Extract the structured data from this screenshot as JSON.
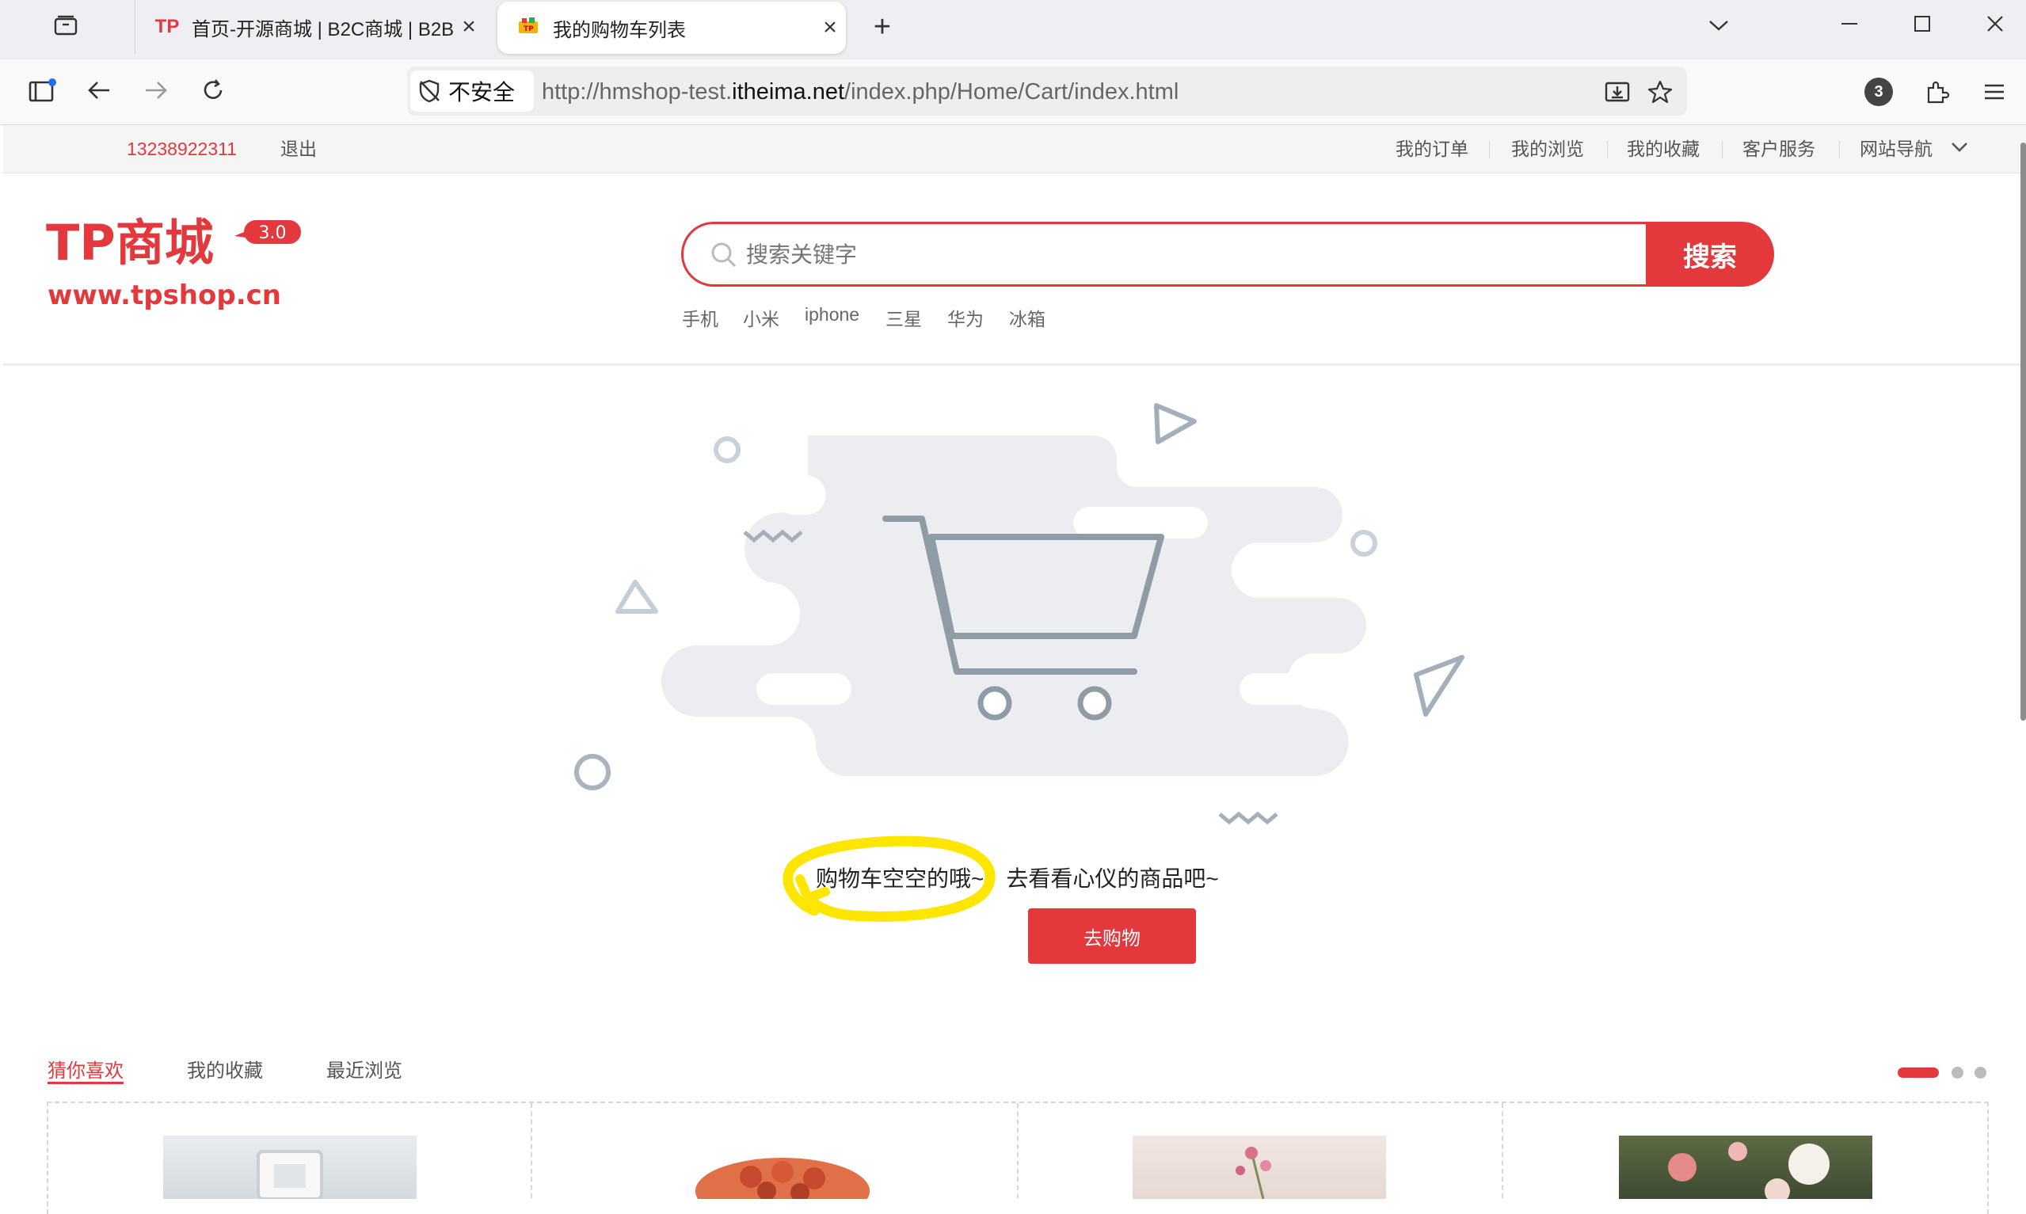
{
  "browser": {
    "tabs": [
      {
        "favicon": "TP",
        "title": "首页-开源商城 | B2C商城 | B2B"
      },
      {
        "favicon": "cart-favicon",
        "title": "我的购物车列表"
      }
    ],
    "security_label": "不安全",
    "url": {
      "scheme_host_prefix": "http://hmshop-test.",
      "domain": "itheima.net",
      "path": "/index.php/Home/Cart/index.html"
    },
    "extensions_badge": "3"
  },
  "site": {
    "topbar": {
      "phone": "13238922311",
      "logout": "退出",
      "links": [
        "我的订单",
        "我的浏览",
        "我的收藏",
        "客户服务",
        "网站导航"
      ]
    },
    "logo": {
      "name": "TP商城",
      "version": "3.0",
      "domain": "www.tpshop.cn"
    },
    "search": {
      "placeholder": "搜索关键字",
      "button": "搜索",
      "hotwords": [
        "手机",
        "小米",
        "iphone",
        "三星",
        "华为",
        "冰箱"
      ]
    },
    "cart": {
      "empty_message": "购物车空空的哦~，去看看心仪的商品吧~",
      "go_shopping": "去购物"
    },
    "recommend": {
      "tabs": [
        "猜你喜欢",
        "我的收藏",
        "最近浏览"
      ]
    }
  },
  "colors": {
    "accent": "#e3393c",
    "annotation": "#ffe600"
  }
}
